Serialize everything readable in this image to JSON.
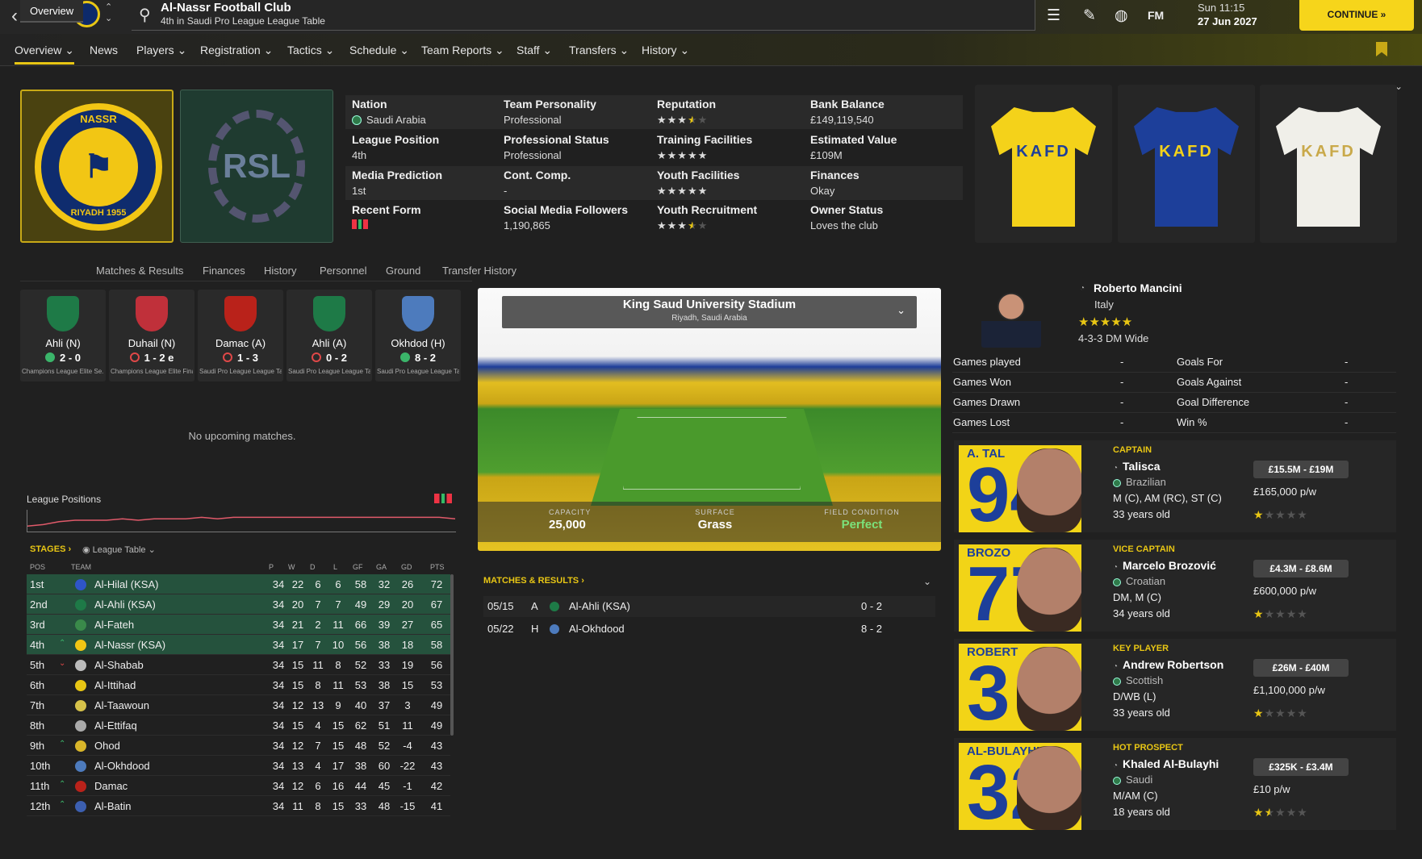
{
  "header": {
    "title": "Al-Nassr Football Club",
    "subtitle": "4th in Saudi Pro League League Table",
    "day_time": "Sun 11:15",
    "date": "27 Jun 2027",
    "continue_label": "CONTINUE",
    "fm_label": "FM"
  },
  "nav": {
    "items": [
      "Overview",
      "News",
      "Players",
      "Registration",
      "Tactics",
      "Schedule",
      "Team Reports",
      "Staff",
      "Transfers",
      "History"
    ]
  },
  "crest": {
    "top_text": "NASSR",
    "bottom_text": "RIYADH 1955"
  },
  "league_logo": {
    "text": "RSL"
  },
  "info": {
    "nation_label": "Nation",
    "nation_value": "Saudi Arabia",
    "personality_label": "Team Personality",
    "personality_value": "Professional",
    "reputation_label": "Reputation",
    "reputation_stars": 3.5,
    "bank_label": "Bank Balance",
    "bank_value": "£149,119,540",
    "league_pos_label": "League Position",
    "league_pos_value": "4th",
    "prof_status_label": "Professional Status",
    "prof_status_value": "Professional",
    "training_label": "Training Facilities",
    "training_stars": 5,
    "est_value_label": "Estimated Value",
    "est_value_value": "£109M",
    "media_label": "Media Prediction",
    "media_value": "1st",
    "cont_comp_label": "Cont. Comp.",
    "cont_comp_value": "-",
    "youth_fac_label": "Youth Facilities",
    "youth_fac_stars": 5,
    "finances_label": "Finances",
    "finances_value": "Okay",
    "form_label": "Recent Form",
    "social_label": "Social Media Followers",
    "social_value": "1,190,865",
    "youth_rec_label": "Youth Recruitment",
    "youth_rec_stars": 3.5,
    "owner_label": "Owner Status",
    "owner_value": "Loves the club"
  },
  "kits": [
    {
      "name": "home",
      "color": "#f4d21a",
      "text": "KAFD",
      "text_color": "#1d3f9a"
    },
    {
      "name": "away",
      "color": "#1d3f9a",
      "text": "KAFD",
      "text_color": "#f4d21a"
    },
    {
      "name": "third",
      "color": "#f0efe9",
      "text": "KAFD",
      "text_color": "#c9a94a"
    }
  ],
  "subtabs": [
    "Overview",
    "Matches & Results",
    "Finances",
    "History",
    "Personnel",
    "Ground",
    "Transfer History"
  ],
  "recent_matches": [
    {
      "team": "Ahli (N)",
      "score": "2 - 0",
      "result": "win",
      "comp": "Champions League Elite Se...",
      "color": "#1e7a47"
    },
    {
      "team": "Duhail (N)",
      "score": "1 - 2 e",
      "result": "loss",
      "comp": "Champions League Elite Final",
      "color": "#c0303a"
    },
    {
      "team": "Damac (A)",
      "score": "1 - 3",
      "result": "loss",
      "comp": "Saudi Pro League League Ta...",
      "color": "#b9221a"
    },
    {
      "team": "Ahli (A)",
      "score": "0 - 2",
      "result": "loss",
      "comp": "Saudi Pro League League Ta...",
      "color": "#1e7a47"
    },
    {
      "team": "Okhdod (H)",
      "score": "8 - 2",
      "result": "win",
      "comp": "Saudi Pro League League Ta...",
      "color": "#4d7bbd"
    }
  ],
  "no_upcoming": "No upcoming matches.",
  "league_positions_label": "League Positions",
  "stages_label": "STAGES",
  "league_table_label": "League Table",
  "table": {
    "headers": [
      "POS",
      "TEAM",
      "P",
      "W",
      "D",
      "L",
      "GF",
      "GA",
      "GD",
      "PTS"
    ],
    "rows": [
      {
        "pos": "1st",
        "trend": "",
        "team": "Al-Hilal (KSA)",
        "p": 34,
        "w": 22,
        "d": 6,
        "l": 6,
        "gf": 58,
        "ga": 32,
        "gd": 26,
        "pts": 72,
        "color": "#2f55c8"
      },
      {
        "pos": "2nd",
        "trend": "",
        "team": "Al-Ahli (KSA)",
        "p": 34,
        "w": 20,
        "d": 7,
        "l": 7,
        "gf": 49,
        "ga": 29,
        "gd": 20,
        "pts": 67,
        "color": "#1e7a47"
      },
      {
        "pos": "3rd",
        "trend": "",
        "team": "Al-Fateh",
        "p": 34,
        "w": 21,
        "d": 2,
        "l": 11,
        "gf": 66,
        "ga": 39,
        "gd": 27,
        "pts": 65,
        "color": "#3a8a4a"
      },
      {
        "pos": "4th",
        "trend": "up",
        "team": "Al-Nassr (KSA)",
        "p": 34,
        "w": 17,
        "d": 7,
        "l": 10,
        "gf": 56,
        "ga": 38,
        "gd": 18,
        "pts": 58,
        "color": "#f2c614"
      },
      {
        "pos": "5th",
        "trend": "down",
        "team": "Al-Shabab",
        "p": 34,
        "w": 15,
        "d": 11,
        "l": 8,
        "gf": 52,
        "ga": 33,
        "gd": 19,
        "pts": 56,
        "color": "#bbbbbb"
      },
      {
        "pos": "6th",
        "trend": "",
        "team": "Al-Ittihad",
        "p": 34,
        "w": 15,
        "d": 8,
        "l": 11,
        "gf": 53,
        "ga": 38,
        "gd": 15,
        "pts": 53,
        "color": "#e8c614"
      },
      {
        "pos": "7th",
        "trend": "",
        "team": "Al-Taawoun",
        "p": 34,
        "w": 12,
        "d": 13,
        "l": 9,
        "gf": 40,
        "ga": 37,
        "gd": 3,
        "pts": 49,
        "color": "#d6c24a"
      },
      {
        "pos": "8th",
        "trend": "",
        "team": "Al-Ettifaq",
        "p": 34,
        "w": 15,
        "d": 4,
        "l": 15,
        "gf": 62,
        "ga": 51,
        "gd": 11,
        "pts": 49,
        "color": "#aaaaaa"
      },
      {
        "pos": "9th",
        "trend": "up",
        "team": "Ohod",
        "p": 34,
        "w": 12,
        "d": 7,
        "l": 15,
        "gf": 48,
        "ga": 52,
        "gd": -4,
        "pts": 43,
        "color": "#d9b62a"
      },
      {
        "pos": "10th",
        "trend": "",
        "team": "Al-Okhdood",
        "p": 34,
        "w": 13,
        "d": 4,
        "l": 17,
        "gf": 38,
        "ga": 60,
        "gd": -22,
        "pts": 43,
        "color": "#4d7bbd"
      },
      {
        "pos": "11th",
        "trend": "up",
        "team": "Damac",
        "p": 34,
        "w": 12,
        "d": 6,
        "l": 16,
        "gf": 44,
        "ga": 45,
        "gd": -1,
        "pts": 42,
        "color": "#b9221a"
      },
      {
        "pos": "12th",
        "trend": "up",
        "team": "Al-Batin",
        "p": 34,
        "w": 11,
        "d": 8,
        "l": 15,
        "gf": 33,
        "ga": 48,
        "gd": -15,
        "pts": 41,
        "color": "#3c5fb0"
      }
    ]
  },
  "stadium": {
    "name": "King Saud University Stadium",
    "location": "Riyadh, Saudi Arabia",
    "capacity_label": "CAPACITY",
    "capacity_value": "25,000",
    "surface_label": "SURFACE",
    "surface_value": "Grass",
    "condition_label": "FIELD CONDITION",
    "condition_value": "Perfect"
  },
  "matches_results_label": "MATCHES & RESULTS",
  "results": [
    {
      "date": "05/15",
      "venue": "A",
      "opponent": "Al-Ahli (KSA)",
      "score": "0 - 2"
    },
    {
      "date": "05/22",
      "venue": "H",
      "opponent": "Al-Okhdood",
      "score": "8 - 2"
    }
  ],
  "manager": {
    "name": "Roberto Mancini",
    "nationality": "Italy",
    "stars": 4,
    "formation": "4-3-3 DM Wide"
  },
  "manager_stats": [
    {
      "l1": "Games played",
      "v1": "-",
      "l2": "Goals For",
      "v2": "-"
    },
    {
      "l1": "Games Won",
      "v1": "-",
      "l2": "Goals Against",
      "v2": "-"
    },
    {
      "l1": "Games Drawn",
      "v1": "-",
      "l2": "Goal Difference",
      "v2": "-"
    },
    {
      "l1": "Games Lost",
      "v1": "-",
      "l2": "Win %",
      "v2": "-"
    }
  ],
  "players": [
    {
      "role": "CAPTAIN",
      "name": "Talisca",
      "nat": "Brazilian",
      "pos": "M (C), AM (RC), ST (C)",
      "age": "33 years old",
      "value": "£15.5M - £19M",
      "wage": "£165,000 p/w",
      "stars": 1,
      "shirt_name": "A. TAL",
      "shirt_num": "94"
    },
    {
      "role": "VICE CAPTAIN",
      "name": "Marcelo Brozović",
      "nat": "Croatian",
      "pos": "DM, M (C)",
      "age": "34 years old",
      "value": "£4.3M - £8.6M",
      "wage": "£600,000 p/w",
      "stars": 1,
      "shirt_name": "BROZO",
      "shirt_num": "77"
    },
    {
      "role": "KEY PLAYER",
      "name": "Andrew Robertson",
      "nat": "Scottish",
      "pos": "D/WB (L)",
      "age": "33 years old",
      "value": "£26M - £40M",
      "wage": "£1,100,000 p/w",
      "stars": 1,
      "shirt_name": "ROBERT",
      "shirt_num": "3"
    },
    {
      "role": "HOT PROSPECT",
      "name": "Khaled Al-Bulayhi",
      "nat": "Saudi",
      "pos": "M/AM (C)",
      "age": "18 years old",
      "value": "£325K - £3.4M",
      "wage": "£10 p/w",
      "stars": 1.5,
      "shirt_name": "AL-BULAYHI",
      "shirt_num": "32"
    }
  ]
}
